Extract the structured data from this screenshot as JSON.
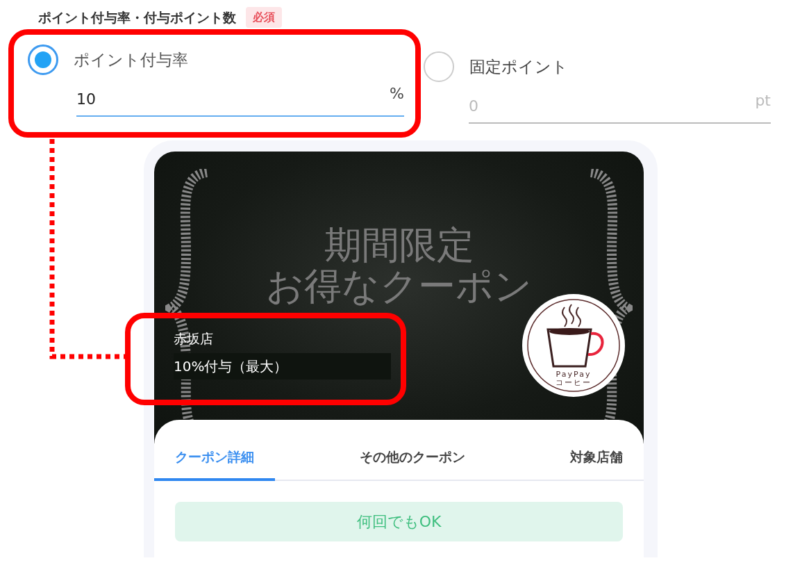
{
  "field": {
    "label": "ポイント付与率・付与ポイント数",
    "required_badge": "必須"
  },
  "options": [
    {
      "label": "ポイント付与率",
      "selected": true,
      "value": "10",
      "unit": "%"
    },
    {
      "label": "固定ポイント",
      "selected": false,
      "value": "0",
      "unit": "pt"
    }
  ],
  "coupon": {
    "banner_lines": [
      "期間限定",
      "お得なクーポン"
    ],
    "logo_lines": [
      "PayPay",
      "コーヒー"
    ],
    "store": "赤坂店",
    "reward": "10%付与（最大）",
    "tabs": [
      {
        "label": "クーポン詳細",
        "selected": true
      },
      {
        "label": "その他のクーポン",
        "selected": false
      },
      {
        "label": "対象店舗",
        "selected": false
      }
    ],
    "usage_badge": "何回でもOK"
  }
}
